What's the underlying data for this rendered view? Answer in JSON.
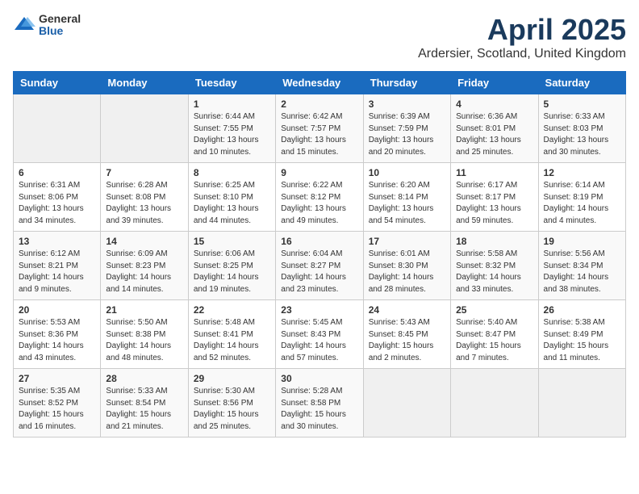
{
  "logo": {
    "general": "General",
    "blue": "Blue"
  },
  "title": {
    "month_year": "April 2025",
    "location": "Ardersier, Scotland, United Kingdom"
  },
  "headers": [
    "Sunday",
    "Monday",
    "Tuesday",
    "Wednesday",
    "Thursday",
    "Friday",
    "Saturday"
  ],
  "weeks": [
    [
      {
        "day": "",
        "info": ""
      },
      {
        "day": "",
        "info": ""
      },
      {
        "day": "1",
        "info": "Sunrise: 6:44 AM\nSunset: 7:55 PM\nDaylight: 13 hours and 10 minutes."
      },
      {
        "day": "2",
        "info": "Sunrise: 6:42 AM\nSunset: 7:57 PM\nDaylight: 13 hours and 15 minutes."
      },
      {
        "day": "3",
        "info": "Sunrise: 6:39 AM\nSunset: 7:59 PM\nDaylight: 13 hours and 20 minutes."
      },
      {
        "day": "4",
        "info": "Sunrise: 6:36 AM\nSunset: 8:01 PM\nDaylight: 13 hours and 25 minutes."
      },
      {
        "day": "5",
        "info": "Sunrise: 6:33 AM\nSunset: 8:03 PM\nDaylight: 13 hours and 30 minutes."
      }
    ],
    [
      {
        "day": "6",
        "info": "Sunrise: 6:31 AM\nSunset: 8:06 PM\nDaylight: 13 hours and 34 minutes."
      },
      {
        "day": "7",
        "info": "Sunrise: 6:28 AM\nSunset: 8:08 PM\nDaylight: 13 hours and 39 minutes."
      },
      {
        "day": "8",
        "info": "Sunrise: 6:25 AM\nSunset: 8:10 PM\nDaylight: 13 hours and 44 minutes."
      },
      {
        "day": "9",
        "info": "Sunrise: 6:22 AM\nSunset: 8:12 PM\nDaylight: 13 hours and 49 minutes."
      },
      {
        "day": "10",
        "info": "Sunrise: 6:20 AM\nSunset: 8:14 PM\nDaylight: 13 hours and 54 minutes."
      },
      {
        "day": "11",
        "info": "Sunrise: 6:17 AM\nSunset: 8:17 PM\nDaylight: 13 hours and 59 minutes."
      },
      {
        "day": "12",
        "info": "Sunrise: 6:14 AM\nSunset: 8:19 PM\nDaylight: 14 hours and 4 minutes."
      }
    ],
    [
      {
        "day": "13",
        "info": "Sunrise: 6:12 AM\nSunset: 8:21 PM\nDaylight: 14 hours and 9 minutes."
      },
      {
        "day": "14",
        "info": "Sunrise: 6:09 AM\nSunset: 8:23 PM\nDaylight: 14 hours and 14 minutes."
      },
      {
        "day": "15",
        "info": "Sunrise: 6:06 AM\nSunset: 8:25 PM\nDaylight: 14 hours and 19 minutes."
      },
      {
        "day": "16",
        "info": "Sunrise: 6:04 AM\nSunset: 8:27 PM\nDaylight: 14 hours and 23 minutes."
      },
      {
        "day": "17",
        "info": "Sunrise: 6:01 AM\nSunset: 8:30 PM\nDaylight: 14 hours and 28 minutes."
      },
      {
        "day": "18",
        "info": "Sunrise: 5:58 AM\nSunset: 8:32 PM\nDaylight: 14 hours and 33 minutes."
      },
      {
        "day": "19",
        "info": "Sunrise: 5:56 AM\nSunset: 8:34 PM\nDaylight: 14 hours and 38 minutes."
      }
    ],
    [
      {
        "day": "20",
        "info": "Sunrise: 5:53 AM\nSunset: 8:36 PM\nDaylight: 14 hours and 43 minutes."
      },
      {
        "day": "21",
        "info": "Sunrise: 5:50 AM\nSunset: 8:38 PM\nDaylight: 14 hours and 48 minutes."
      },
      {
        "day": "22",
        "info": "Sunrise: 5:48 AM\nSunset: 8:41 PM\nDaylight: 14 hours and 52 minutes."
      },
      {
        "day": "23",
        "info": "Sunrise: 5:45 AM\nSunset: 8:43 PM\nDaylight: 14 hours and 57 minutes."
      },
      {
        "day": "24",
        "info": "Sunrise: 5:43 AM\nSunset: 8:45 PM\nDaylight: 15 hours and 2 minutes."
      },
      {
        "day": "25",
        "info": "Sunrise: 5:40 AM\nSunset: 8:47 PM\nDaylight: 15 hours and 7 minutes."
      },
      {
        "day": "26",
        "info": "Sunrise: 5:38 AM\nSunset: 8:49 PM\nDaylight: 15 hours and 11 minutes."
      }
    ],
    [
      {
        "day": "27",
        "info": "Sunrise: 5:35 AM\nSunset: 8:52 PM\nDaylight: 15 hours and 16 minutes."
      },
      {
        "day": "28",
        "info": "Sunrise: 5:33 AM\nSunset: 8:54 PM\nDaylight: 15 hours and 21 minutes."
      },
      {
        "day": "29",
        "info": "Sunrise: 5:30 AM\nSunset: 8:56 PM\nDaylight: 15 hours and 25 minutes."
      },
      {
        "day": "30",
        "info": "Sunrise: 5:28 AM\nSunset: 8:58 PM\nDaylight: 15 hours and 30 minutes."
      },
      {
        "day": "",
        "info": ""
      },
      {
        "day": "",
        "info": ""
      },
      {
        "day": "",
        "info": ""
      }
    ]
  ]
}
